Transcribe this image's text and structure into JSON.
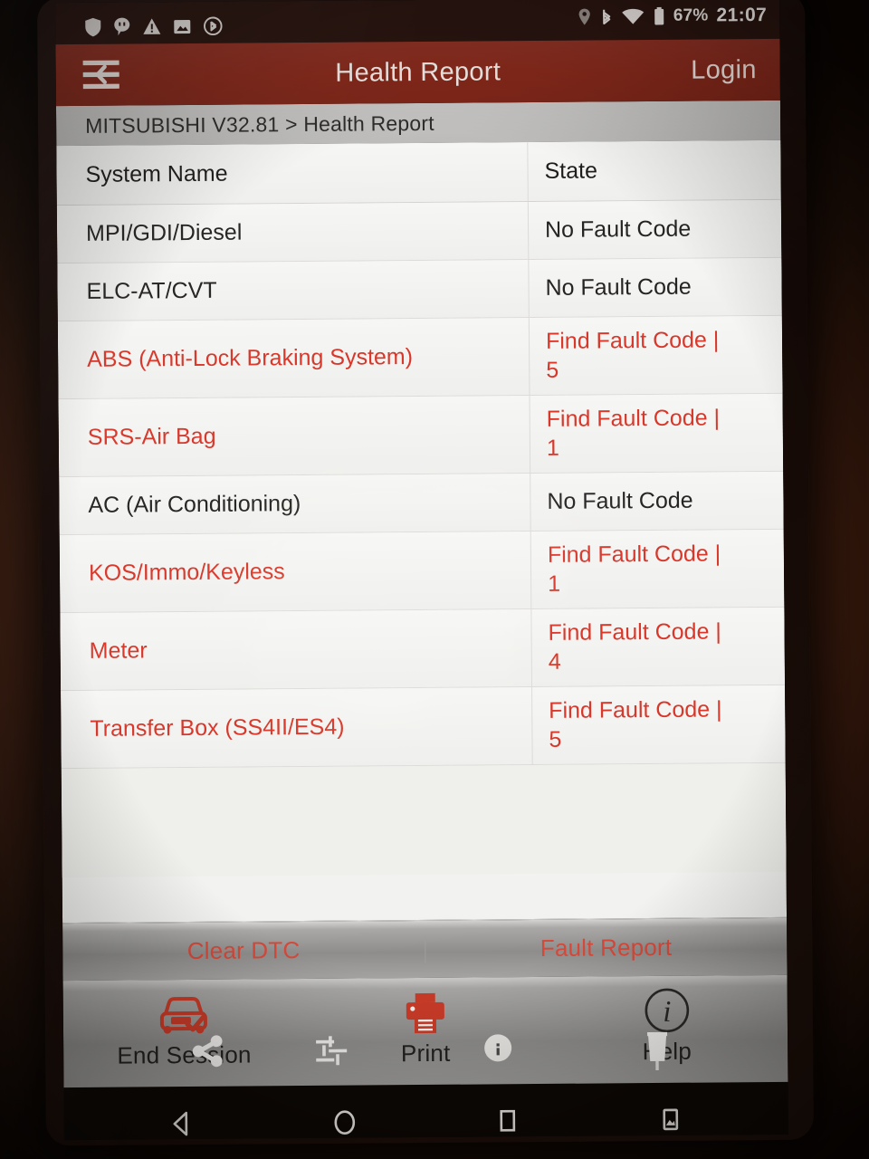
{
  "status_bar": {
    "left_icons": [
      "shield-icon",
      "hangouts-icon",
      "warning-triangle-icon",
      "image-icon",
      "bluetooth-circle-icon"
    ],
    "right_icons": [
      "location-pin-icon",
      "bluetooth-icon",
      "wifi-icon",
      "battery-icon"
    ],
    "battery_label": "67%",
    "time": "21:07"
  },
  "appbar": {
    "menu_icon": "menu-back-icon",
    "title": "Health Report",
    "login_label": "Login",
    "background_color": "#87291b"
  },
  "breadcrumb": {
    "text": "MITSUBISHI V32.81 > Health Report"
  },
  "table": {
    "headers": {
      "name": "System Name",
      "state": "State"
    },
    "rows": [
      {
        "name": "MPI/GDI/Diesel",
        "state": "No Fault Code",
        "fault": false
      },
      {
        "name": "ELC-AT/CVT",
        "state": "No Fault Code",
        "fault": false
      },
      {
        "name": "ABS (Anti-Lock Braking System)",
        "state": "Find Fault Code | 5",
        "fault": true
      },
      {
        "name": "SRS-Air Bag",
        "state": "Find Fault Code | 1",
        "fault": true
      },
      {
        "name": "AC (Air Conditioning)",
        "state": "No Fault Code",
        "fault": false
      },
      {
        "name": "KOS/Immo/Keyless",
        "state": "Find Fault Code | 1",
        "fault": true
      },
      {
        "name": "Meter",
        "state": "Find Fault Code | 4",
        "fault": true
      },
      {
        "name": "Transfer Box (SS4II/ES4)",
        "state": "Find Fault Code | 5",
        "fault": true
      }
    ],
    "fault_color": "#d8372a",
    "normal_color": "#262423"
  },
  "actions": {
    "clear_dtc": "Clear DTC",
    "fault_report": "Fault Report"
  },
  "toolbar": {
    "items": [
      {
        "label": "End Session",
        "icon": "car-check-icon"
      },
      {
        "label": "Print",
        "icon": "printer-icon"
      },
      {
        "label": "Help",
        "icon": "info-circle-icon"
      }
    ]
  },
  "overlay_icons": [
    "share-icon",
    "tune-sliders-icon",
    "info-dot-icon",
    "trash-icon"
  ],
  "navbar": {
    "buttons": [
      "back-icon",
      "home-icon",
      "recents-icon",
      "screenshot-icon"
    ]
  }
}
